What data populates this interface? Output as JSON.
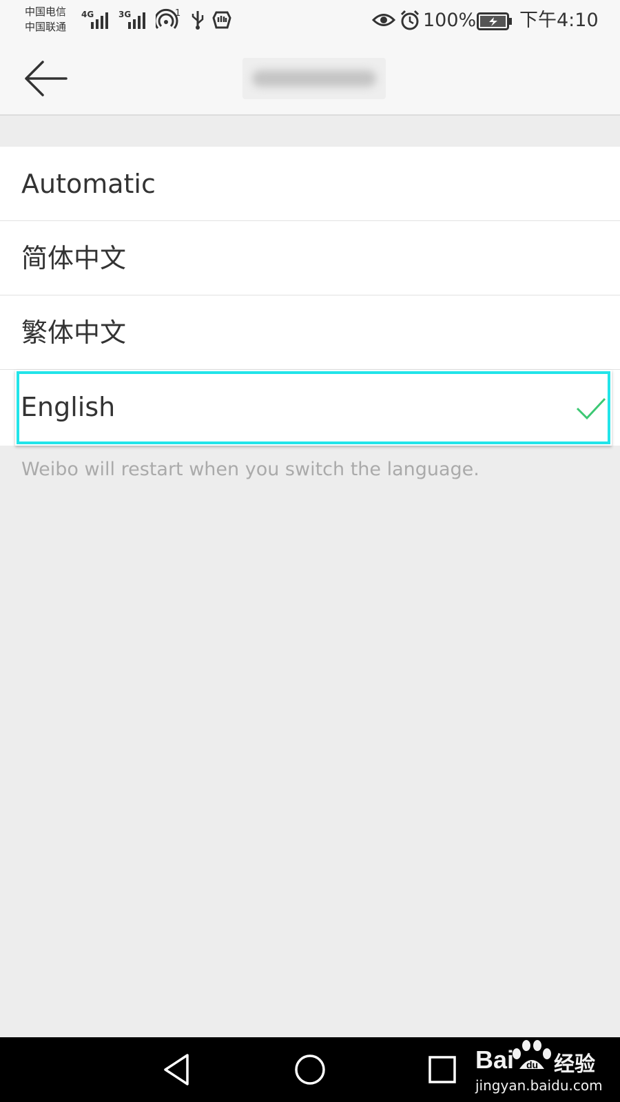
{
  "status_bar": {
    "carrier_1": "中国电信",
    "carrier_2": "中国联通",
    "network_1": "4G",
    "network_2": "3G",
    "hotspot_count": "1",
    "battery": "100%",
    "time": "下午4:10"
  },
  "languages": [
    {
      "label": "Automatic",
      "selected": false
    },
    {
      "label": "简体中文",
      "selected": false
    },
    {
      "label": "繁体中文",
      "selected": false
    },
    {
      "label": "English",
      "selected": true
    }
  ],
  "footnote": "Weibo will restart when you switch the language.",
  "watermark": {
    "brand": "Bai",
    "brand_cn": "经验",
    "url": "jingyan.baidu.com"
  },
  "colors": {
    "highlight": "#22e4e9",
    "check": "#3cc873",
    "background": "#ededed"
  }
}
